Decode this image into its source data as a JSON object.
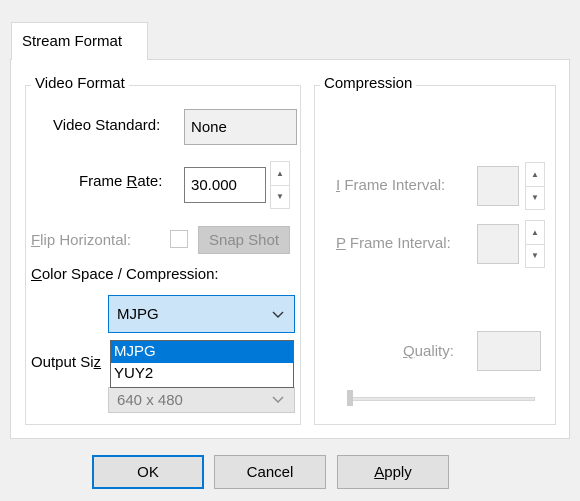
{
  "tab": {
    "label": "Stream Format"
  },
  "video_format": {
    "title": "Video Format",
    "standard_label": "Video Standard:",
    "standard_value": "None",
    "frame_rate_label_pre": "Frame ",
    "frame_rate_label_key": "R",
    "frame_rate_label_post": "ate:",
    "frame_rate_value": "30.000",
    "flip_label_key": "F",
    "flip_label_post": "lip Horizontal:",
    "snapshot_label": "Snap Shot",
    "color_space_label_key": "C",
    "color_space_label_post": "olor Space / Compression:",
    "color_space_selected": "MJPG",
    "color_space_options": [
      "MJPG",
      "YUY2"
    ],
    "output_size_label_pre": "Output Si",
    "output_size_label_key": "z",
    "output_size_value": "640 x 480"
  },
  "compression": {
    "title": "Compression",
    "i_frame_label_key": "I",
    "i_frame_label_post": " Frame Interval:",
    "p_frame_label_key": "P",
    "p_frame_label_post": " Frame Interval:",
    "quality_label_key": "Q",
    "quality_label_post": "uality:"
  },
  "buttons": {
    "ok": "OK",
    "cancel": "Cancel",
    "apply_key": "A",
    "apply_post": "pply"
  },
  "icons": {
    "spin_up": "▲",
    "spin_down": "▼"
  },
  "colors": {
    "accent": "#0078d7",
    "selection_bg": "#cce4f7",
    "dialog_bg": "#f0f0f0"
  }
}
